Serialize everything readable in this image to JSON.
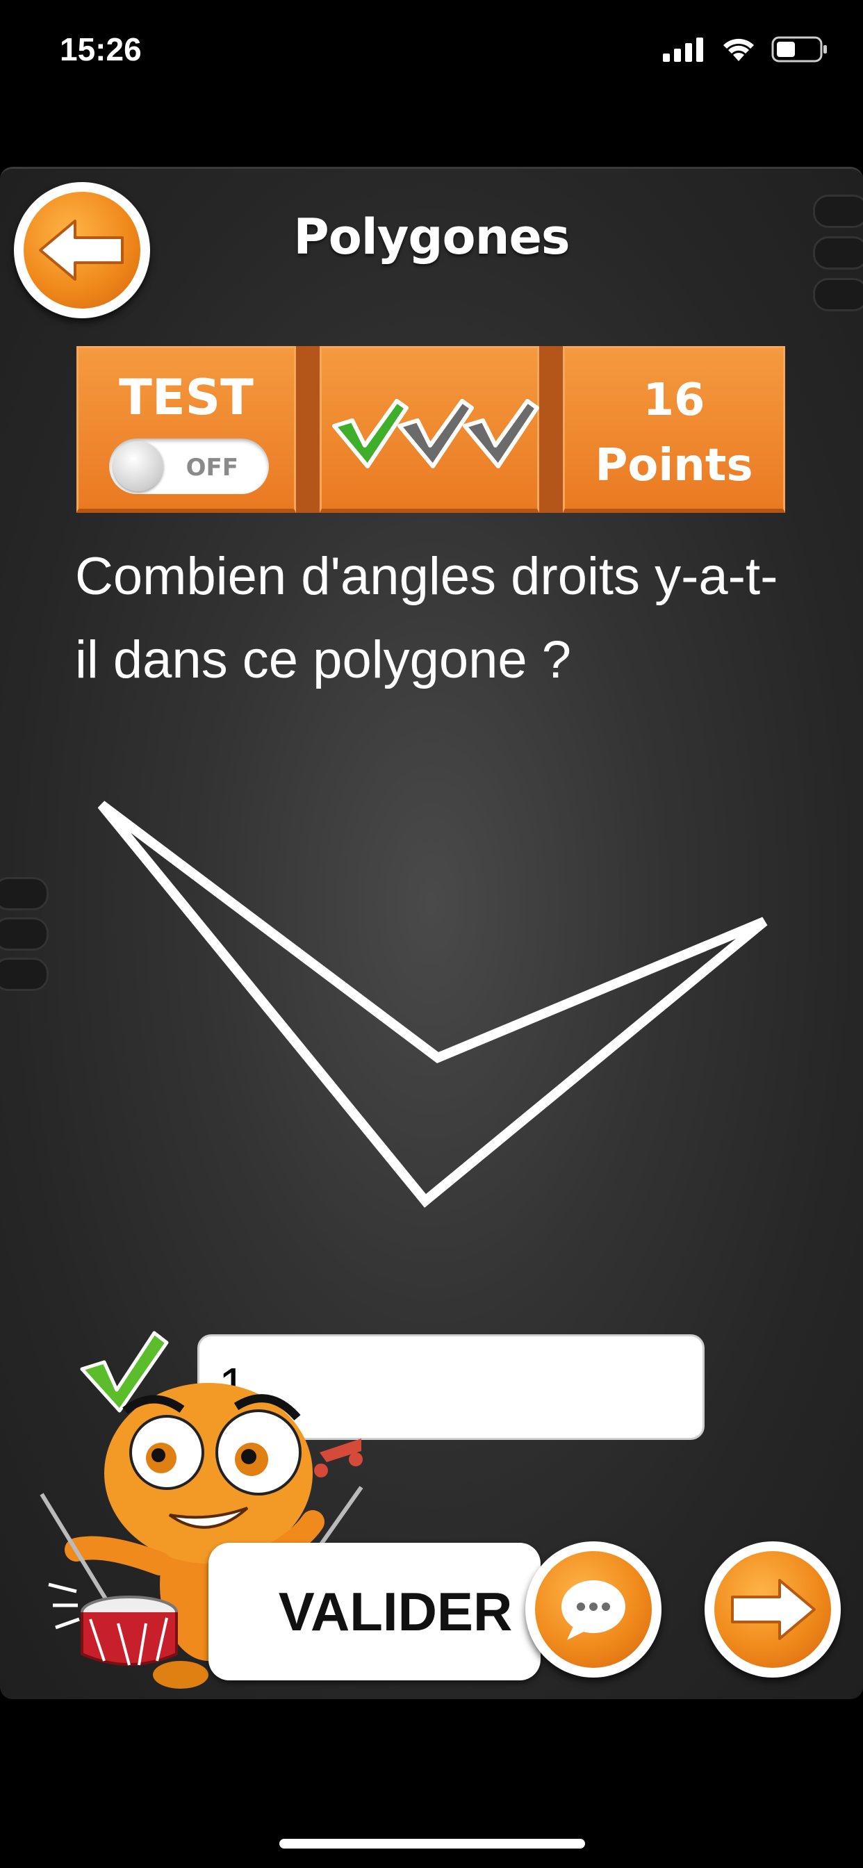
{
  "status_bar": {
    "time": "15:26"
  },
  "header": {
    "title": "Polygones"
  },
  "score_panel": {
    "test_label": "TEST",
    "toggle_state": "OFF",
    "checks": [
      {
        "color": "#3fae2a"
      },
      {
        "color": "#6b6b6b"
      },
      {
        "color": "#6b6b6b"
      }
    ],
    "points_value": "16",
    "points_label": "Points"
  },
  "question": {
    "text": "Combien d'angles droits y-a-t-il dans ce polygone ?"
  },
  "answer": {
    "value": "1"
  },
  "actions": {
    "validate_label": "VALIDER"
  },
  "colors": {
    "accent_orange": "#ea7a22",
    "check_green": "#3fae2a",
    "board": "#2e2e2e"
  }
}
